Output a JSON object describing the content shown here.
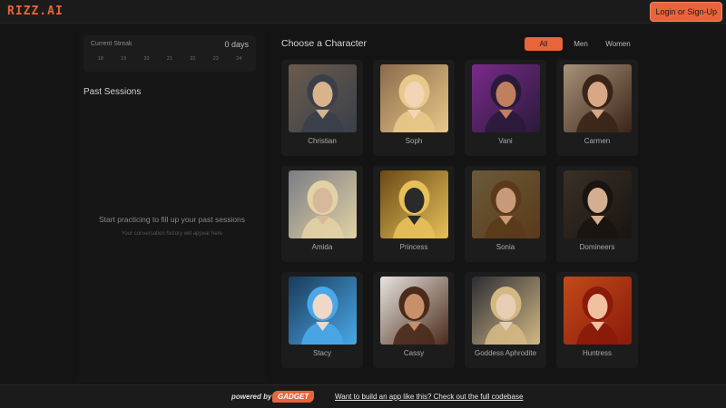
{
  "header": {
    "logo": "RIZZ.AI",
    "login_label": "Login or Sign-Up"
  },
  "streak": {
    "label": "Current Streak",
    "value": "0 days",
    "days": [
      "18",
      "19",
      "20",
      "21",
      "22",
      "23",
      "24"
    ]
  },
  "sessions": {
    "title": "Past Sessions",
    "empty_title": "Start practicing to fill up your past sessions",
    "empty_subtitle": "Your conversation history will appear here"
  },
  "characters": {
    "title": "Choose a Character",
    "filters": [
      "All",
      "Men",
      "Women"
    ],
    "active_filter": "All",
    "items": [
      {
        "name": "Christian",
        "palette": [
          "#6b5b4b",
          "#3a3f4a",
          "#d9b38c"
        ]
      },
      {
        "name": "Soph",
        "palette": [
          "#8a6a4a",
          "#e9c98a",
          "#f2d5b6"
        ]
      },
      {
        "name": "Vani",
        "palette": [
          "#7a2a8a",
          "#2a1a3a",
          "#c08060"
        ]
      },
      {
        "name": "Carmen",
        "palette": [
          "#a8927a",
          "#3a2418",
          "#d6a886"
        ]
      },
      {
        "name": "Amida",
        "palette": [
          "#7a7d85",
          "#e2d2a4",
          "#d7b89a"
        ]
      },
      {
        "name": "Princess",
        "palette": [
          "#6a4a16",
          "#e8c05a",
          "#2a2a2a"
        ]
      },
      {
        "name": "Sonia",
        "palette": [
          "#6a5a3a",
          "#5a3a1a",
          "#c89a78"
        ]
      },
      {
        "name": "Domineers",
        "palette": [
          "#3a3026",
          "#1a1410",
          "#d4ae90"
        ]
      },
      {
        "name": "Stacy",
        "palette": [
          "#1a3a5a",
          "#4aa8e8",
          "#f0d8c8"
        ]
      },
      {
        "name": "Cassy",
        "palette": [
          "#e8e4e0",
          "#4a2a1a",
          "#c8906a"
        ]
      },
      {
        "name": "Goddess Aphrodite",
        "palette": [
          "#2a2d34",
          "#d4b884",
          "#e6cdb4"
        ]
      },
      {
        "name": "Huntress",
        "palette": [
          "#c24a1a",
          "#8a1a0a",
          "#f0c0a0"
        ]
      }
    ]
  },
  "footer": {
    "powered_by": "powered by",
    "brand": "GADGET",
    "link_text": "Want to build an app like this? Check out the full codebase"
  },
  "colors": {
    "accent": "#e8643a",
    "background": "#141414",
    "card": "#1c1c1c"
  }
}
